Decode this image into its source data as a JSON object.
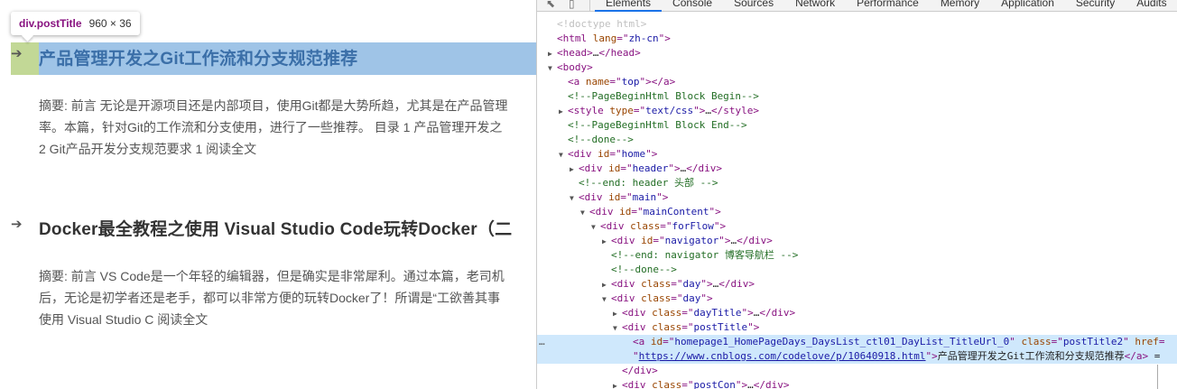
{
  "inspector_tooltip": {
    "element": "div.postTitle",
    "size": "960 × 36"
  },
  "left": {
    "posts": [
      {
        "title": "产品管理开发之Git工作流和分支规范推荐",
        "summary_lines": [
          "摘要: 前言 无论是开源项目还是内部项目，使用Git都是大势所趋，尤其是在产品管理",
          "率。本篇，针对Git的工作流和分支使用，进行了一些推荐。 目录 1 产品管理开发之",
          "2 Git产品开发分支规范要求 1 阅读全文"
        ]
      },
      {
        "title": "Docker最全教程之使用 Visual Studio Code玩转Docker（二",
        "summary_lines": [
          "摘要: 前言 VS Code是一个年轻的编辑器，但是确实是非常犀利。通过本篇，老司机",
          "后，无论是初学者还是老手，都可以非常方便的玩转Docker了！所谓是“工欲善其事",
          "使用 Visual Studio C 阅读全文"
        ]
      }
    ]
  },
  "devtools": {
    "tabs": [
      "Elements",
      "Console",
      "Sources",
      "Network",
      "Performance",
      "Memory",
      "Application",
      "Security",
      "Audits"
    ],
    "active_tab": "Elements",
    "nodes": [
      {
        "indent": 0,
        "tri": "",
        "parts": [
          [
            "dt",
            "<!doctype html>"
          ]
        ]
      },
      {
        "indent": 0,
        "tri": "",
        "parts": [
          [
            "tg",
            "<html "
          ],
          [
            "an",
            "lang"
          ],
          [
            "tg",
            "=\""
          ],
          [
            "av",
            "zh-cn"
          ],
          [
            "tg",
            "\">"
          ]
        ]
      },
      {
        "indent": 0,
        "tri": "▶",
        "parts": [
          [
            "tg",
            "<head>"
          ],
          [
            "tx",
            "…"
          ],
          [
            "tg",
            "</head>"
          ]
        ]
      },
      {
        "indent": 0,
        "tri": "▼",
        "parts": [
          [
            "tg",
            "<body>"
          ]
        ]
      },
      {
        "indent": 1,
        "tri": "",
        "parts": [
          [
            "tg",
            "<a "
          ],
          [
            "an",
            "name"
          ],
          [
            "tg",
            "=\""
          ],
          [
            "av",
            "top"
          ],
          [
            "tg",
            "\"></a>"
          ]
        ]
      },
      {
        "indent": 1,
        "tri": "",
        "parts": [
          [
            "cm",
            "<!--PageBeginHtml Block Begin-->"
          ]
        ]
      },
      {
        "indent": 1,
        "tri": "▶",
        "parts": [
          [
            "tg",
            "<style "
          ],
          [
            "an",
            "type"
          ],
          [
            "tg",
            "=\""
          ],
          [
            "av",
            "text/css"
          ],
          [
            "tg",
            "\">"
          ],
          [
            "tx",
            "…"
          ],
          [
            "tg",
            "</style>"
          ]
        ]
      },
      {
        "indent": 1,
        "tri": "",
        "parts": [
          [
            "cm",
            "<!--PageBeginHtml Block End-->"
          ]
        ]
      },
      {
        "indent": 1,
        "tri": "",
        "parts": [
          [
            "cm",
            "<!--done-->"
          ]
        ]
      },
      {
        "indent": 1,
        "tri": "▼",
        "parts": [
          [
            "tg",
            "<div "
          ],
          [
            "an",
            "id"
          ],
          [
            "tg",
            "=\""
          ],
          [
            "av",
            "home"
          ],
          [
            "tg",
            "\">"
          ]
        ]
      },
      {
        "indent": 2,
        "tri": "▶",
        "parts": [
          [
            "tg",
            "<div "
          ],
          [
            "an",
            "id"
          ],
          [
            "tg",
            "=\""
          ],
          [
            "av",
            "header"
          ],
          [
            "tg",
            "\">"
          ],
          [
            "tx",
            "…"
          ],
          [
            "tg",
            "</div>"
          ]
        ]
      },
      {
        "indent": 2,
        "tri": "",
        "parts": [
          [
            "cm",
            "<!--end: header 头部 -->"
          ]
        ]
      },
      {
        "indent": 2,
        "tri": "▼",
        "parts": [
          [
            "tg",
            "<div "
          ],
          [
            "an",
            "id"
          ],
          [
            "tg",
            "=\""
          ],
          [
            "av",
            "main"
          ],
          [
            "tg",
            "\">"
          ]
        ]
      },
      {
        "indent": 3,
        "tri": "▼",
        "parts": [
          [
            "tg",
            "<div "
          ],
          [
            "an",
            "id"
          ],
          [
            "tg",
            "=\""
          ],
          [
            "av",
            "mainContent"
          ],
          [
            "tg",
            "\">"
          ]
        ]
      },
      {
        "indent": 4,
        "tri": "▼",
        "parts": [
          [
            "tg",
            "<div "
          ],
          [
            "an",
            "class"
          ],
          [
            "tg",
            "=\""
          ],
          [
            "av",
            "forFlow"
          ],
          [
            "tg",
            "\">"
          ]
        ]
      },
      {
        "indent": 5,
        "tri": "▶",
        "parts": [
          [
            "tg",
            "<div "
          ],
          [
            "an",
            "id"
          ],
          [
            "tg",
            "=\""
          ],
          [
            "av",
            "navigator"
          ],
          [
            "tg",
            "\">"
          ],
          [
            "tx",
            "…"
          ],
          [
            "tg",
            "</div>"
          ]
        ]
      },
      {
        "indent": 5,
        "tri": "",
        "parts": [
          [
            "cm",
            "<!--end: navigator 博客导航栏 -->"
          ]
        ]
      },
      {
        "indent": 5,
        "tri": "",
        "parts": [
          [
            "cm",
            "<!--done-->"
          ]
        ]
      },
      {
        "indent": 5,
        "tri": "▶",
        "parts": [
          [
            "tg",
            "<div "
          ],
          [
            "an",
            "class"
          ],
          [
            "tg",
            "=\""
          ],
          [
            "av",
            "day"
          ],
          [
            "tg",
            "\">"
          ],
          [
            "tx",
            "…"
          ],
          [
            "tg",
            "</div>"
          ]
        ]
      },
      {
        "indent": 5,
        "tri": "▼",
        "parts": [
          [
            "tg",
            "<div "
          ],
          [
            "an",
            "class"
          ],
          [
            "tg",
            "=\""
          ],
          [
            "av",
            "day"
          ],
          [
            "tg",
            "\">"
          ]
        ]
      },
      {
        "indent": 6,
        "tri": "▶",
        "parts": [
          [
            "tg",
            "<div "
          ],
          [
            "an",
            "class"
          ],
          [
            "tg",
            "=\""
          ],
          [
            "av",
            "dayTitle"
          ],
          [
            "tg",
            "\">"
          ],
          [
            "tx",
            "…"
          ],
          [
            "tg",
            "</div>"
          ]
        ]
      },
      {
        "indent": 6,
        "tri": "▼",
        "parts": [
          [
            "tg",
            "<div "
          ],
          [
            "an",
            "class"
          ],
          [
            "tg",
            "=\""
          ],
          [
            "av",
            "postTitle"
          ],
          [
            "tg",
            "\">"
          ]
        ]
      },
      {
        "indent": 7,
        "tri": "",
        "sel": true,
        "dots": "…",
        "parts": [
          [
            "tg",
            "<a "
          ],
          [
            "an",
            "id"
          ],
          [
            "tg",
            "=\""
          ],
          [
            "av",
            "homepage1_HomePageDays_DaysList_ctl01_DayList_TitleUrl_0"
          ],
          [
            "tg",
            "\" "
          ],
          [
            "an",
            "class"
          ],
          [
            "tg",
            "=\""
          ],
          [
            "av",
            "postTitle2"
          ],
          [
            "tg",
            "\" "
          ],
          [
            "an",
            "href"
          ],
          [
            "tg",
            "="
          ]
        ]
      },
      {
        "indent": 7,
        "tri": "",
        "sel": true,
        "parts": [
          [
            "tg",
            "\""
          ],
          [
            "lk",
            "https://www.cnblogs.com/codelove/p/10640918.html"
          ],
          [
            "tg",
            "\">"
          ],
          [
            "tx",
            "产品管理开发之Git工作流和分支规范推荐"
          ],
          [
            "tg",
            "</a>"
          ],
          [
            "tx",
            " ="
          ]
        ]
      },
      {
        "indent": 6,
        "tri": "",
        "parts": [
          [
            "tg",
            "</div>"
          ]
        ]
      },
      {
        "indent": 6,
        "tri": "▶",
        "parts": [
          [
            "tg",
            "<div "
          ],
          [
            "an",
            "class"
          ],
          [
            "tg",
            "=\""
          ],
          [
            "av",
            "postCon"
          ],
          [
            "tg",
            "\">"
          ],
          [
            "tx",
            "…"
          ],
          [
            "tg",
            "</div>"
          ]
        ]
      }
    ]
  }
}
